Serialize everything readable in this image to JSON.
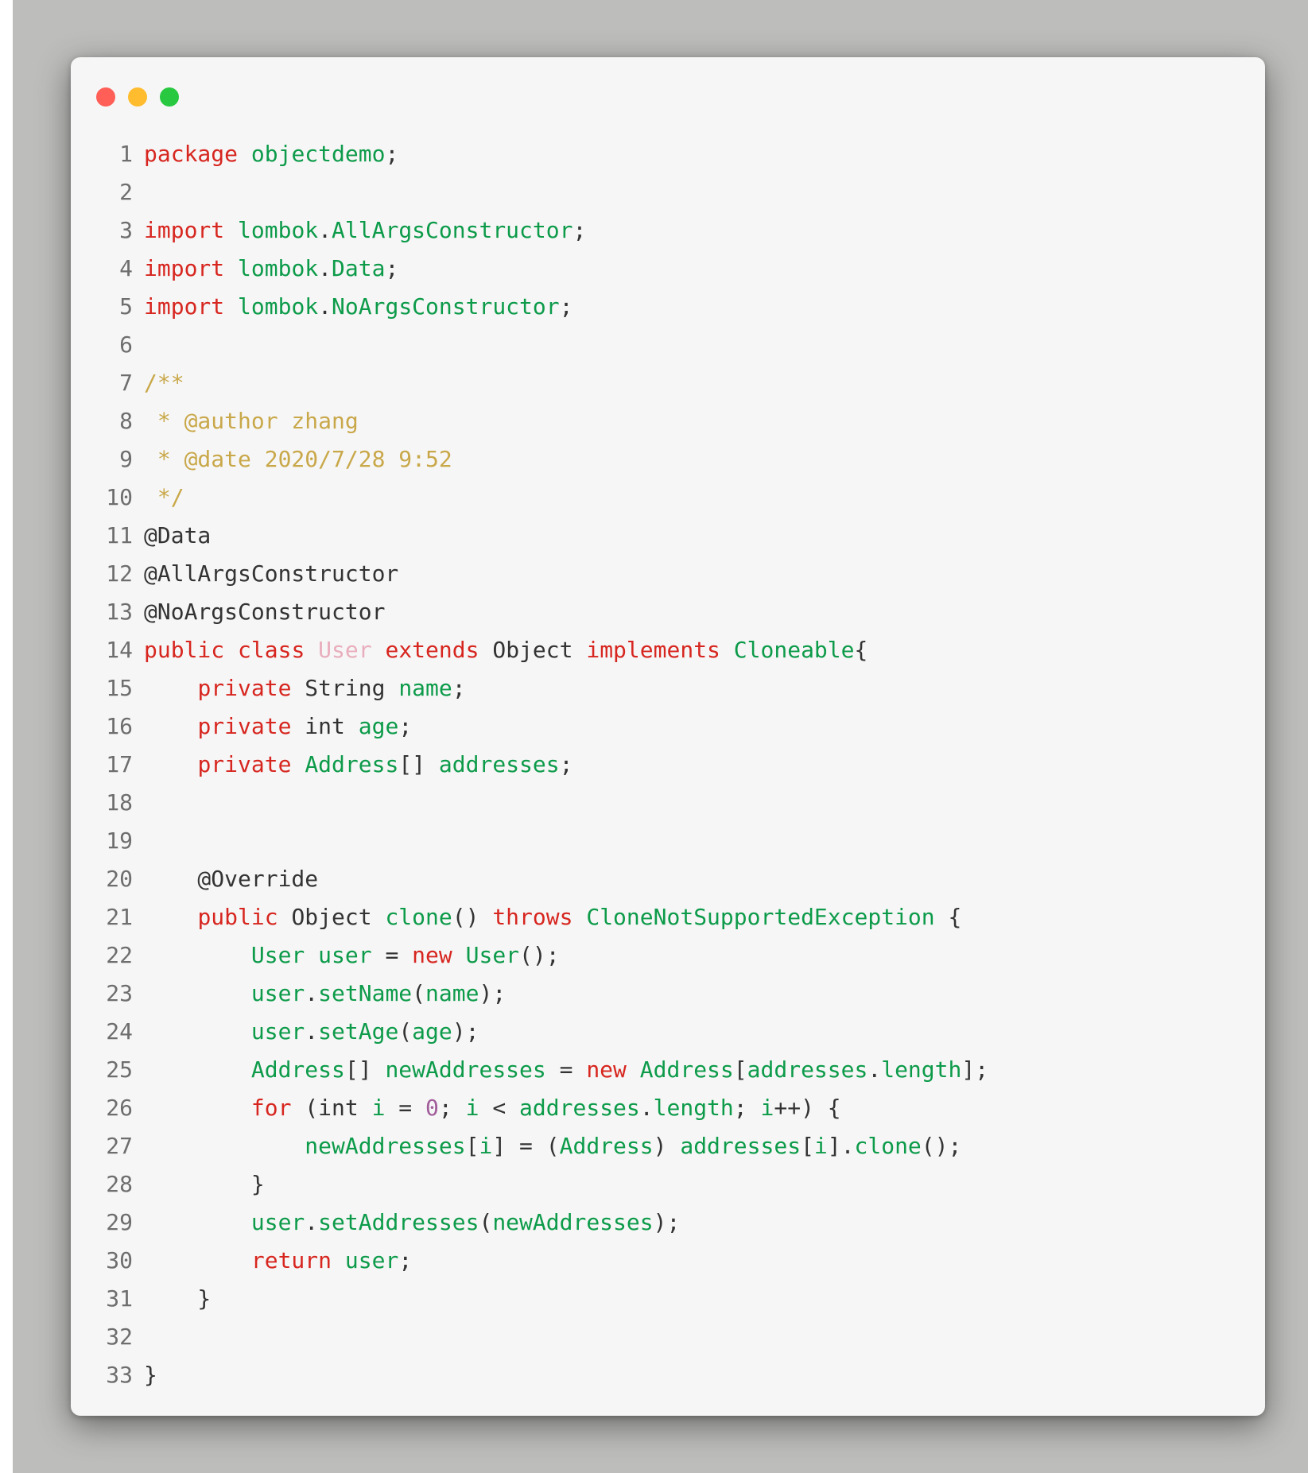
{
  "window": {
    "buttons": [
      {
        "name": "close",
        "color": "#ff5f57"
      },
      {
        "name": "minimize",
        "color": "#febc2e"
      },
      {
        "name": "maximize",
        "color": "#28c840"
      }
    ]
  },
  "colors": {
    "keyword": "#d7261f",
    "identifier": "#0d9b4a",
    "comment": "#c9a84a",
    "plain": "#333333",
    "class_name": "#e9aebd",
    "number": "#a15c9a",
    "line_number": "#6e6e6e",
    "card_background": "#f6f6f6",
    "page_background": "#bdbdbb"
  },
  "code": {
    "lines": [
      {
        "n": "1",
        "tokens": [
          {
            "t": "kw",
            "v": "package"
          },
          {
            "t": "pl",
            "v": " "
          },
          {
            "t": "id",
            "v": "objectdemo"
          },
          {
            "t": "pl",
            "v": ";"
          }
        ]
      },
      {
        "n": "2",
        "tokens": []
      },
      {
        "n": "3",
        "tokens": [
          {
            "t": "kw",
            "v": "import"
          },
          {
            "t": "pl",
            "v": " "
          },
          {
            "t": "id",
            "v": "lombok"
          },
          {
            "t": "pl",
            "v": "."
          },
          {
            "t": "id",
            "v": "AllArgsConstructor"
          },
          {
            "t": "pl",
            "v": ";"
          }
        ]
      },
      {
        "n": "4",
        "tokens": [
          {
            "t": "kw",
            "v": "import"
          },
          {
            "t": "pl",
            "v": " "
          },
          {
            "t": "id",
            "v": "lombok"
          },
          {
            "t": "pl",
            "v": "."
          },
          {
            "t": "id",
            "v": "Data"
          },
          {
            "t": "pl",
            "v": ";"
          }
        ]
      },
      {
        "n": "5",
        "tokens": [
          {
            "t": "kw",
            "v": "import"
          },
          {
            "t": "pl",
            "v": " "
          },
          {
            "t": "id",
            "v": "lombok"
          },
          {
            "t": "pl",
            "v": "."
          },
          {
            "t": "id",
            "v": "NoArgsConstructor"
          },
          {
            "t": "pl",
            "v": ";"
          }
        ]
      },
      {
        "n": "6",
        "tokens": []
      },
      {
        "n": "7",
        "tokens": [
          {
            "t": "cm",
            "v": "/**"
          }
        ]
      },
      {
        "n": "8",
        "tokens": [
          {
            "t": "cm",
            "v": " * @author zhang"
          }
        ]
      },
      {
        "n": "9",
        "tokens": [
          {
            "t": "cm",
            "v": " * @date 2020/7/28 9:52"
          }
        ]
      },
      {
        "n": "10",
        "tokens": [
          {
            "t": "cm",
            "v": " */"
          }
        ]
      },
      {
        "n": "11",
        "tokens": [
          {
            "t": "pl",
            "v": "@Data"
          }
        ]
      },
      {
        "n": "12",
        "tokens": [
          {
            "t": "pl",
            "v": "@AllArgsConstructor"
          }
        ]
      },
      {
        "n": "13",
        "tokens": [
          {
            "t": "pl",
            "v": "@NoArgsConstructor"
          }
        ]
      },
      {
        "n": "14",
        "tokens": [
          {
            "t": "kw",
            "v": "public"
          },
          {
            "t": "pl",
            "v": " "
          },
          {
            "t": "kw",
            "v": "class"
          },
          {
            "t": "pl",
            "v": " "
          },
          {
            "t": "cls",
            "v": "User"
          },
          {
            "t": "pl",
            "v": " "
          },
          {
            "t": "kw",
            "v": "extends"
          },
          {
            "t": "pl",
            "v": " Object "
          },
          {
            "t": "kw",
            "v": "implements"
          },
          {
            "t": "pl",
            "v": " "
          },
          {
            "t": "id",
            "v": "Cloneable"
          },
          {
            "t": "pl",
            "v": "{"
          }
        ]
      },
      {
        "n": "15",
        "tokens": [
          {
            "t": "pl",
            "v": "    "
          },
          {
            "t": "kw",
            "v": "private"
          },
          {
            "t": "pl",
            "v": " String "
          },
          {
            "t": "id",
            "v": "name"
          },
          {
            "t": "pl",
            "v": ";"
          }
        ]
      },
      {
        "n": "16",
        "tokens": [
          {
            "t": "pl",
            "v": "    "
          },
          {
            "t": "kw",
            "v": "private"
          },
          {
            "t": "pl",
            "v": " int "
          },
          {
            "t": "id",
            "v": "age"
          },
          {
            "t": "pl",
            "v": ";"
          }
        ]
      },
      {
        "n": "17",
        "tokens": [
          {
            "t": "pl",
            "v": "    "
          },
          {
            "t": "kw",
            "v": "private"
          },
          {
            "t": "pl",
            "v": " "
          },
          {
            "t": "id",
            "v": "Address"
          },
          {
            "t": "pl",
            "v": "[] "
          },
          {
            "t": "id",
            "v": "addresses"
          },
          {
            "t": "pl",
            "v": ";"
          }
        ]
      },
      {
        "n": "18",
        "tokens": []
      },
      {
        "n": "19",
        "tokens": []
      },
      {
        "n": "20",
        "tokens": [
          {
            "t": "pl",
            "v": "    @Override"
          }
        ]
      },
      {
        "n": "21",
        "tokens": [
          {
            "t": "pl",
            "v": "    "
          },
          {
            "t": "kw",
            "v": "public"
          },
          {
            "t": "pl",
            "v": " Object "
          },
          {
            "t": "id",
            "v": "clone"
          },
          {
            "t": "pl",
            "v": "() "
          },
          {
            "t": "kw",
            "v": "throws"
          },
          {
            "t": "pl",
            "v": " "
          },
          {
            "t": "id",
            "v": "CloneNotSupportedException"
          },
          {
            "t": "pl",
            "v": " {"
          }
        ]
      },
      {
        "n": "22",
        "tokens": [
          {
            "t": "pl",
            "v": "        "
          },
          {
            "t": "id",
            "v": "User"
          },
          {
            "t": "pl",
            "v": " "
          },
          {
            "t": "id",
            "v": "user"
          },
          {
            "t": "pl",
            "v": " = "
          },
          {
            "t": "kw",
            "v": "new"
          },
          {
            "t": "pl",
            "v": " "
          },
          {
            "t": "id",
            "v": "User"
          },
          {
            "t": "pl",
            "v": "();"
          }
        ]
      },
      {
        "n": "23",
        "tokens": [
          {
            "t": "pl",
            "v": "        "
          },
          {
            "t": "id",
            "v": "user"
          },
          {
            "t": "pl",
            "v": "."
          },
          {
            "t": "id",
            "v": "setName"
          },
          {
            "t": "pl",
            "v": "("
          },
          {
            "t": "id",
            "v": "name"
          },
          {
            "t": "pl",
            "v": ");"
          }
        ]
      },
      {
        "n": "24",
        "tokens": [
          {
            "t": "pl",
            "v": "        "
          },
          {
            "t": "id",
            "v": "user"
          },
          {
            "t": "pl",
            "v": "."
          },
          {
            "t": "id",
            "v": "setAge"
          },
          {
            "t": "pl",
            "v": "("
          },
          {
            "t": "id",
            "v": "age"
          },
          {
            "t": "pl",
            "v": ");"
          }
        ]
      },
      {
        "n": "25",
        "tokens": [
          {
            "t": "pl",
            "v": "        "
          },
          {
            "t": "id",
            "v": "Address"
          },
          {
            "t": "pl",
            "v": "[] "
          },
          {
            "t": "id",
            "v": "newAddresses"
          },
          {
            "t": "pl",
            "v": " = "
          },
          {
            "t": "kw",
            "v": "new"
          },
          {
            "t": "pl",
            "v": " "
          },
          {
            "t": "id",
            "v": "Address"
          },
          {
            "t": "pl",
            "v": "["
          },
          {
            "t": "id",
            "v": "addresses"
          },
          {
            "t": "pl",
            "v": "."
          },
          {
            "t": "id",
            "v": "length"
          },
          {
            "t": "pl",
            "v": "];"
          }
        ]
      },
      {
        "n": "26",
        "tokens": [
          {
            "t": "pl",
            "v": "        "
          },
          {
            "t": "kw",
            "v": "for"
          },
          {
            "t": "pl",
            "v": " (int "
          },
          {
            "t": "id",
            "v": "i"
          },
          {
            "t": "pl",
            "v": " = "
          },
          {
            "t": "num",
            "v": "0"
          },
          {
            "t": "pl",
            "v": "; "
          },
          {
            "t": "id",
            "v": "i"
          },
          {
            "t": "pl",
            "v": " < "
          },
          {
            "t": "id",
            "v": "addresses"
          },
          {
            "t": "pl",
            "v": "."
          },
          {
            "t": "id",
            "v": "length"
          },
          {
            "t": "pl",
            "v": "; "
          },
          {
            "t": "id",
            "v": "i"
          },
          {
            "t": "pl",
            "v": "++) {"
          }
        ]
      },
      {
        "n": "27",
        "tokens": [
          {
            "t": "pl",
            "v": "            "
          },
          {
            "t": "id",
            "v": "newAddresses"
          },
          {
            "t": "pl",
            "v": "["
          },
          {
            "t": "id",
            "v": "i"
          },
          {
            "t": "pl",
            "v": "] = ("
          },
          {
            "t": "id",
            "v": "Address"
          },
          {
            "t": "pl",
            "v": ") "
          },
          {
            "t": "id",
            "v": "addresses"
          },
          {
            "t": "pl",
            "v": "["
          },
          {
            "t": "id",
            "v": "i"
          },
          {
            "t": "pl",
            "v": "]."
          },
          {
            "t": "id",
            "v": "clone"
          },
          {
            "t": "pl",
            "v": "();"
          }
        ]
      },
      {
        "n": "28",
        "tokens": [
          {
            "t": "pl",
            "v": "        }"
          }
        ]
      },
      {
        "n": "29",
        "tokens": [
          {
            "t": "pl",
            "v": "        "
          },
          {
            "t": "id",
            "v": "user"
          },
          {
            "t": "pl",
            "v": "."
          },
          {
            "t": "id",
            "v": "setAddresses"
          },
          {
            "t": "pl",
            "v": "("
          },
          {
            "t": "id",
            "v": "newAddresses"
          },
          {
            "t": "pl",
            "v": ");"
          }
        ]
      },
      {
        "n": "30",
        "tokens": [
          {
            "t": "pl",
            "v": "        "
          },
          {
            "t": "kw",
            "v": "return"
          },
          {
            "t": "pl",
            "v": " "
          },
          {
            "t": "id",
            "v": "user"
          },
          {
            "t": "pl",
            "v": ";"
          }
        ]
      },
      {
        "n": "31",
        "tokens": [
          {
            "t": "pl",
            "v": "    }"
          }
        ]
      },
      {
        "n": "32",
        "tokens": []
      },
      {
        "n": "33",
        "tokens": [
          {
            "t": "pl",
            "v": "}"
          }
        ]
      }
    ]
  }
}
